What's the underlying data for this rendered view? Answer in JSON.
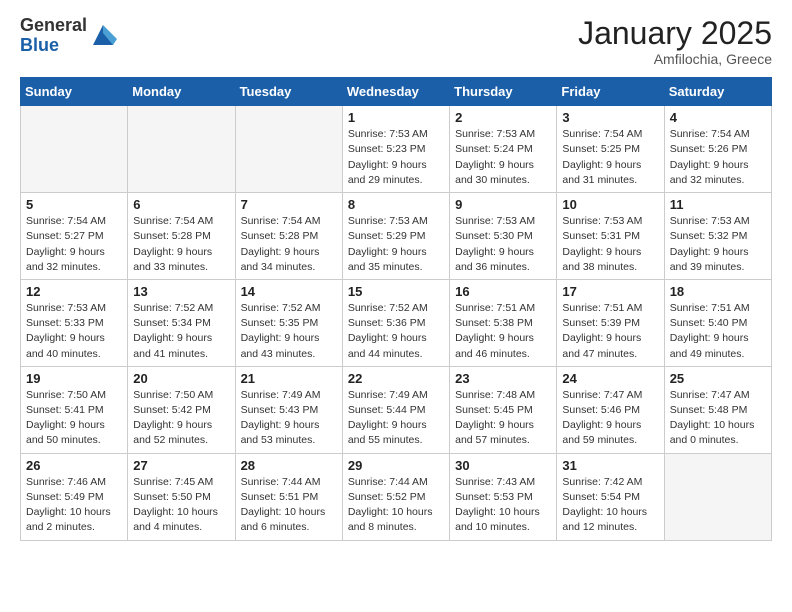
{
  "logo": {
    "general": "General",
    "blue": "Blue"
  },
  "header": {
    "month": "January 2025",
    "location": "Amfilochia, Greece"
  },
  "weekdays": [
    "Sunday",
    "Monday",
    "Tuesday",
    "Wednesday",
    "Thursday",
    "Friday",
    "Saturday"
  ],
  "weeks": [
    [
      {
        "day": "",
        "sunrise": "",
        "sunset": "",
        "daylight": ""
      },
      {
        "day": "",
        "sunrise": "",
        "sunset": "",
        "daylight": ""
      },
      {
        "day": "",
        "sunrise": "",
        "sunset": "",
        "daylight": ""
      },
      {
        "day": "1",
        "sunrise": "Sunrise: 7:53 AM",
        "sunset": "Sunset: 5:23 PM",
        "daylight": "Daylight: 9 hours and 29 minutes."
      },
      {
        "day": "2",
        "sunrise": "Sunrise: 7:53 AM",
        "sunset": "Sunset: 5:24 PM",
        "daylight": "Daylight: 9 hours and 30 minutes."
      },
      {
        "day": "3",
        "sunrise": "Sunrise: 7:54 AM",
        "sunset": "Sunset: 5:25 PM",
        "daylight": "Daylight: 9 hours and 31 minutes."
      },
      {
        "day": "4",
        "sunrise": "Sunrise: 7:54 AM",
        "sunset": "Sunset: 5:26 PM",
        "daylight": "Daylight: 9 hours and 32 minutes."
      }
    ],
    [
      {
        "day": "5",
        "sunrise": "Sunrise: 7:54 AM",
        "sunset": "Sunset: 5:27 PM",
        "daylight": "Daylight: 9 hours and 32 minutes."
      },
      {
        "day": "6",
        "sunrise": "Sunrise: 7:54 AM",
        "sunset": "Sunset: 5:28 PM",
        "daylight": "Daylight: 9 hours and 33 minutes."
      },
      {
        "day": "7",
        "sunrise": "Sunrise: 7:54 AM",
        "sunset": "Sunset: 5:28 PM",
        "daylight": "Daylight: 9 hours and 34 minutes."
      },
      {
        "day": "8",
        "sunrise": "Sunrise: 7:53 AM",
        "sunset": "Sunset: 5:29 PM",
        "daylight": "Daylight: 9 hours and 35 minutes."
      },
      {
        "day": "9",
        "sunrise": "Sunrise: 7:53 AM",
        "sunset": "Sunset: 5:30 PM",
        "daylight": "Daylight: 9 hours and 36 minutes."
      },
      {
        "day": "10",
        "sunrise": "Sunrise: 7:53 AM",
        "sunset": "Sunset: 5:31 PM",
        "daylight": "Daylight: 9 hours and 38 minutes."
      },
      {
        "day": "11",
        "sunrise": "Sunrise: 7:53 AM",
        "sunset": "Sunset: 5:32 PM",
        "daylight": "Daylight: 9 hours and 39 minutes."
      }
    ],
    [
      {
        "day": "12",
        "sunrise": "Sunrise: 7:53 AM",
        "sunset": "Sunset: 5:33 PM",
        "daylight": "Daylight: 9 hours and 40 minutes."
      },
      {
        "day": "13",
        "sunrise": "Sunrise: 7:52 AM",
        "sunset": "Sunset: 5:34 PM",
        "daylight": "Daylight: 9 hours and 41 minutes."
      },
      {
        "day": "14",
        "sunrise": "Sunrise: 7:52 AM",
        "sunset": "Sunset: 5:35 PM",
        "daylight": "Daylight: 9 hours and 43 minutes."
      },
      {
        "day": "15",
        "sunrise": "Sunrise: 7:52 AM",
        "sunset": "Sunset: 5:36 PM",
        "daylight": "Daylight: 9 hours and 44 minutes."
      },
      {
        "day": "16",
        "sunrise": "Sunrise: 7:51 AM",
        "sunset": "Sunset: 5:38 PM",
        "daylight": "Daylight: 9 hours and 46 minutes."
      },
      {
        "day": "17",
        "sunrise": "Sunrise: 7:51 AM",
        "sunset": "Sunset: 5:39 PM",
        "daylight": "Daylight: 9 hours and 47 minutes."
      },
      {
        "day": "18",
        "sunrise": "Sunrise: 7:51 AM",
        "sunset": "Sunset: 5:40 PM",
        "daylight": "Daylight: 9 hours and 49 minutes."
      }
    ],
    [
      {
        "day": "19",
        "sunrise": "Sunrise: 7:50 AM",
        "sunset": "Sunset: 5:41 PM",
        "daylight": "Daylight: 9 hours and 50 minutes."
      },
      {
        "day": "20",
        "sunrise": "Sunrise: 7:50 AM",
        "sunset": "Sunset: 5:42 PM",
        "daylight": "Daylight: 9 hours and 52 minutes."
      },
      {
        "day": "21",
        "sunrise": "Sunrise: 7:49 AM",
        "sunset": "Sunset: 5:43 PM",
        "daylight": "Daylight: 9 hours and 53 minutes."
      },
      {
        "day": "22",
        "sunrise": "Sunrise: 7:49 AM",
        "sunset": "Sunset: 5:44 PM",
        "daylight": "Daylight: 9 hours and 55 minutes."
      },
      {
        "day": "23",
        "sunrise": "Sunrise: 7:48 AM",
        "sunset": "Sunset: 5:45 PM",
        "daylight": "Daylight: 9 hours and 57 minutes."
      },
      {
        "day": "24",
        "sunrise": "Sunrise: 7:47 AM",
        "sunset": "Sunset: 5:46 PM",
        "daylight": "Daylight: 9 hours and 59 minutes."
      },
      {
        "day": "25",
        "sunrise": "Sunrise: 7:47 AM",
        "sunset": "Sunset: 5:48 PM",
        "daylight": "Daylight: 10 hours and 0 minutes."
      }
    ],
    [
      {
        "day": "26",
        "sunrise": "Sunrise: 7:46 AM",
        "sunset": "Sunset: 5:49 PM",
        "daylight": "Daylight: 10 hours and 2 minutes."
      },
      {
        "day": "27",
        "sunrise": "Sunrise: 7:45 AM",
        "sunset": "Sunset: 5:50 PM",
        "daylight": "Daylight: 10 hours and 4 minutes."
      },
      {
        "day": "28",
        "sunrise": "Sunrise: 7:44 AM",
        "sunset": "Sunset: 5:51 PM",
        "daylight": "Daylight: 10 hours and 6 minutes."
      },
      {
        "day": "29",
        "sunrise": "Sunrise: 7:44 AM",
        "sunset": "Sunset: 5:52 PM",
        "daylight": "Daylight: 10 hours and 8 minutes."
      },
      {
        "day": "30",
        "sunrise": "Sunrise: 7:43 AM",
        "sunset": "Sunset: 5:53 PM",
        "daylight": "Daylight: 10 hours and 10 minutes."
      },
      {
        "day": "31",
        "sunrise": "Sunrise: 7:42 AM",
        "sunset": "Sunset: 5:54 PM",
        "daylight": "Daylight: 10 hours and 12 minutes."
      },
      {
        "day": "",
        "sunrise": "",
        "sunset": "",
        "daylight": ""
      }
    ]
  ]
}
